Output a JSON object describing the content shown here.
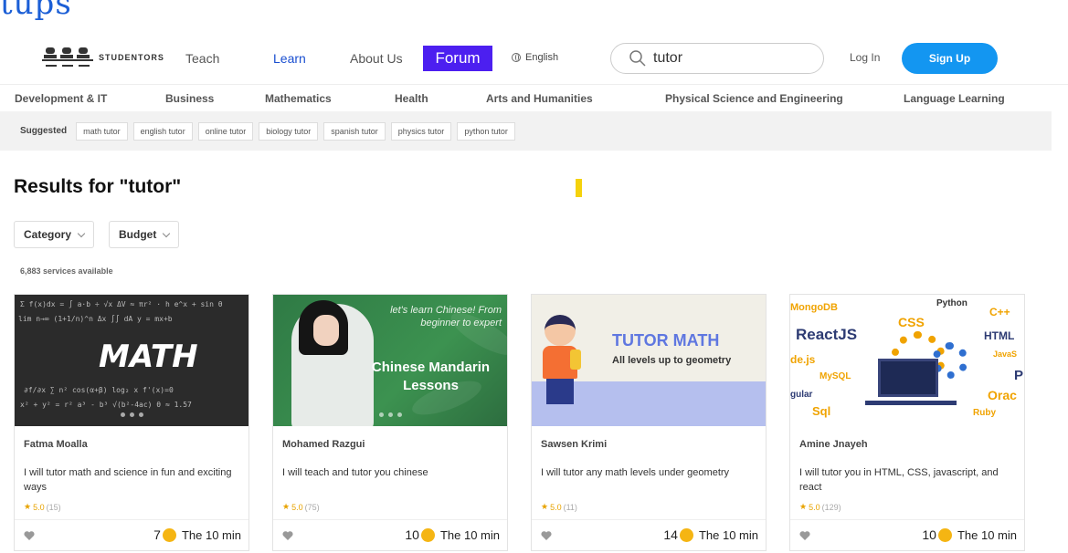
{
  "header_partial": "tups",
  "nav": {
    "logo_text": "STUDENTORS",
    "teach": "Teach",
    "learn": "Learn",
    "about": "About Us",
    "forum": "Forum",
    "language": "English",
    "search_value": "tutor",
    "login": "Log In",
    "signup": "Sign Up"
  },
  "categories": [
    "Development & IT",
    "Business",
    "Mathematics",
    "Health",
    "Arts and Humanities",
    "Physical Science and Engineering",
    "Language Learning"
  ],
  "suggested": {
    "label": "Suggested",
    "chips": [
      "math tutor",
      "english tutor",
      "online tutor",
      "biology tutor",
      "spanish tutor",
      "physics tutor",
      "python tutor"
    ]
  },
  "results": {
    "title": "Results for \"tutor\"",
    "filters": [
      "Category",
      "Budget"
    ],
    "count": "6,883 services available"
  },
  "cards": [
    {
      "image_text": "MATH",
      "seller": "Fatma Moalla",
      "title": "I will tutor math and science in fun and exciting ways",
      "rating": "5.0",
      "reviews": "(15)",
      "price": "7",
      "duration": "The 10 min"
    },
    {
      "image_script": "let's learn Chinese! From beginner to expert",
      "image_text": "Chinese Mandarin Lessons",
      "seller": "Mohamed Razgui",
      "title": "I will teach and tutor you chinese",
      "rating": "5.0",
      "reviews": "(75)",
      "price": "10",
      "duration": "The 10 min"
    },
    {
      "image_text": "TUTOR MATH",
      "image_subtext": "All levels up to geometry",
      "seller": "Sawsen Krimi",
      "title": "I will tutor any math levels under geometry",
      "rating": "5.0",
      "reviews": "(11)",
      "price": "14",
      "duration": "The 10 min"
    },
    {
      "image_words": [
        "MongoDB",
        "Python",
        "C++",
        "CSS",
        "ReactJS",
        "HTML",
        "de.js",
        "JavaS",
        "MySQL",
        "P",
        "gular",
        "Orac",
        "Sql",
        "Ruby"
      ],
      "seller": "Amine Jnayeh",
      "title": "I will tutor you in HTML, CSS, javascript, and react",
      "rating": "5.0",
      "reviews": "(129)",
      "price": "10",
      "duration": "The 10 min"
    }
  ],
  "colors": {
    "forum_bg": "#4c1ff0",
    "signup_bg": "#1396f1",
    "learn_link": "#1a4fd0",
    "star": "#e8a300",
    "coin": "#f5b513"
  }
}
